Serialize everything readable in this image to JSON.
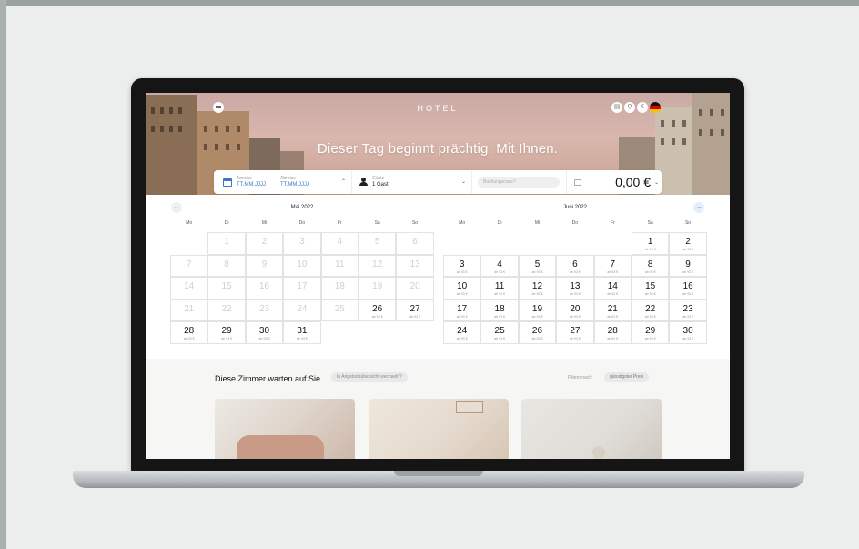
{
  "hotel": {
    "logo": "HOTEL",
    "headline": "Dieser Tag beginnt prächtig. Mit Ihnen."
  },
  "booking": {
    "arrival_label": "Anreise",
    "arrival_placeholder": "TT.MM.JJJJ",
    "departure_label": "Abreise",
    "departure_placeholder": "TT.MM.JJJJ",
    "guests_label": "Gäste",
    "guests_value": "1 Gast",
    "code_placeholder": "Buchungscode?",
    "price": "0,00 €"
  },
  "calendar": {
    "weekdays": [
      "Mo",
      "Di",
      "Mi",
      "Do",
      "Fr",
      "Sa",
      "So"
    ],
    "months": [
      {
        "title": "Mai 2022",
        "offset": 1,
        "days": [
          {
            "n": "1",
            "p": ""
          },
          {
            "n": "2",
            "p": ""
          },
          {
            "n": "3",
            "p": ""
          },
          {
            "n": "4",
            "p": ""
          },
          {
            "n": "5",
            "p": ""
          },
          {
            "n": "6",
            "p": ""
          },
          {
            "n": "7",
            "p": ""
          },
          {
            "n": "8",
            "p": ""
          },
          {
            "n": "9",
            "p": ""
          },
          {
            "n": "10",
            "p": ""
          },
          {
            "n": "11",
            "p": ""
          },
          {
            "n": "12",
            "p": ""
          },
          {
            "n": "13",
            "p": ""
          },
          {
            "n": "14",
            "p": ""
          },
          {
            "n": "15",
            "p": ""
          },
          {
            "n": "16",
            "p": ""
          },
          {
            "n": "17",
            "p": ""
          },
          {
            "n": "18",
            "p": ""
          },
          {
            "n": "19",
            "p": ""
          },
          {
            "n": "20",
            "p": ""
          },
          {
            "n": "21",
            "p": ""
          },
          {
            "n": "22",
            "p": ""
          },
          {
            "n": "23",
            "p": ""
          },
          {
            "n": "24",
            "p": ""
          },
          {
            "n": "25",
            "p": ""
          },
          {
            "n": "26",
            "p": "ab 93 €"
          },
          {
            "n": "27",
            "p": "ab 93 €"
          },
          {
            "n": "28",
            "p": "ab 93 €"
          },
          {
            "n": "29",
            "p": "ab 93 €"
          },
          {
            "n": "30",
            "p": "ab 93 €"
          },
          {
            "n": "31",
            "p": "ab 93 €"
          }
        ]
      },
      {
        "title": "Juni 2022",
        "offset": 5,
        "days": [
          {
            "n": "1",
            "p": "ab 93 €"
          },
          {
            "n": "2",
            "p": "ab 93 €"
          },
          {
            "n": "3",
            "p": "ab 93 €"
          },
          {
            "n": "4",
            "p": "ab 93 €"
          },
          {
            "n": "5",
            "p": "ab 93 €"
          },
          {
            "n": "6",
            "p": "ab 93 €"
          },
          {
            "n": "7",
            "p": "ab 93 €"
          },
          {
            "n": "8",
            "p": "ab 93 €"
          },
          {
            "n": "9",
            "p": "ab 93 €"
          },
          {
            "n": "10",
            "p": "ab 93 €"
          },
          {
            "n": "11",
            "p": "ab 93 €"
          },
          {
            "n": "12",
            "p": "ab 93 €"
          },
          {
            "n": "13",
            "p": "ab 93 €"
          },
          {
            "n": "14",
            "p": "ab 93 €"
          },
          {
            "n": "15",
            "p": "ab 93 €"
          },
          {
            "n": "16",
            "p": "ab 93 €"
          },
          {
            "n": "17",
            "p": "ab 93 €"
          },
          {
            "n": "18",
            "p": "ab 93 €"
          },
          {
            "n": "19",
            "p": "ab 93 €"
          },
          {
            "n": "20",
            "p": "ab 93 €"
          },
          {
            "n": "21",
            "p": "ab 93 €"
          },
          {
            "n": "22",
            "p": "ab 93 €"
          },
          {
            "n": "23",
            "p": "ab 93 €"
          },
          {
            "n": "24",
            "p": "ab 93 €"
          },
          {
            "n": "25",
            "p": "ab 93 €"
          },
          {
            "n": "26",
            "p": "ab 93 €"
          },
          {
            "n": "27",
            "p": "ab 93 €"
          },
          {
            "n": "28",
            "p": "ab 93 €"
          },
          {
            "n": "29",
            "p": "ab 93 €"
          },
          {
            "n": "30",
            "p": "ab 93 €"
          }
        ]
      }
    ]
  },
  "rooms": {
    "title": "Diese Zimmer warten auf Sie.",
    "switch_label": "In Angebotsübersicht wechseln?",
    "filter_label": "Filtern nach:",
    "filter_value": "günstigster Preis"
  },
  "icons": {
    "menu": "menu-icon",
    "calendar": "calendar-icon",
    "guests": "person-icon",
    "cart": "bag-icon",
    "prev": "arrow-left-icon",
    "next": "arrow-right-icon",
    "language": "flag-de-icon"
  },
  "colors": {
    "accent": "#3b78c6"
  }
}
